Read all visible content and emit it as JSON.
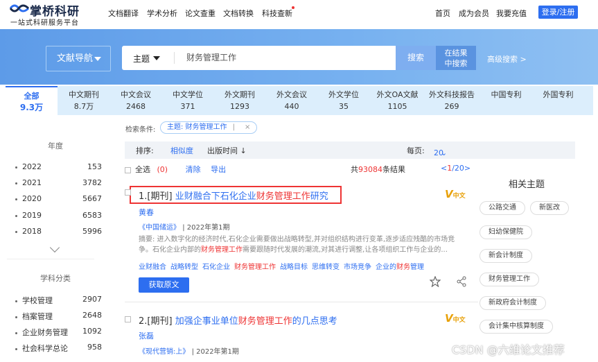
{
  "logo": {
    "brand": "掌桥科研",
    "tagline": "一站式科研服务平台"
  },
  "topnav": [
    "文档翻译",
    "学术分析",
    "论文查重",
    "文档转换",
    "科技查新"
  ],
  "topright": {
    "home": "首页",
    "member": "成为会员",
    "recharge": "我要充值",
    "login": "登录/注册"
  },
  "search": {
    "doc_nav": "文献导航",
    "field": "主题",
    "query": "财务管理工作",
    "search_btn": "搜索",
    "within_btn_l1": "在结果",
    "within_btn_l2": "中搜索",
    "advanced": "高级搜索 >"
  },
  "tabs": [
    {
      "label": "全部",
      "count": "9.3万"
    },
    {
      "label": "中文期刊",
      "count": "8.7万"
    },
    {
      "label": "中文会议",
      "count": "2468"
    },
    {
      "label": "中文学位",
      "count": "371"
    },
    {
      "label": "外文期刊",
      "count": "1293"
    },
    {
      "label": "外文会议",
      "count": "440"
    },
    {
      "label": "外文学位",
      "count": "35"
    },
    {
      "label": "外文OA文献",
      "count": "1105"
    },
    {
      "label": "外文科技报告",
      "count": "269"
    },
    {
      "label": "中国专利",
      "count": ""
    },
    {
      "label": "外国专利",
      "count": ""
    }
  ],
  "sidebar": {
    "year_title": "年度",
    "years": [
      {
        "y": "2022",
        "n": "153"
      },
      {
        "y": "2021",
        "n": "3782"
      },
      {
        "y": "2020",
        "n": "5667"
      },
      {
        "y": "2019",
        "n": "6583"
      },
      {
        "y": "2018",
        "n": "5996"
      }
    ],
    "subject_title": "学科分类",
    "subjects": [
      {
        "y": "学校管理",
        "n": "2907"
      },
      {
        "y": "档案管理",
        "n": "2648"
      },
      {
        "y": "企业财务管理",
        "n": "1092"
      },
      {
        "y": "社会科学总论",
        "n": "958"
      }
    ]
  },
  "filter": {
    "label": "检索条件:",
    "chip": "主题: 财务管理工作",
    "chip_sep": "|",
    "chip_close": "×"
  },
  "sort": {
    "label": "排序:",
    "relevance": "相似度",
    "date": "出版时间 ↓",
    "perpage_label": "每页:",
    "perpage": "20"
  },
  "selbar": {
    "select_all": "全选",
    "selected": "(0)",
    "clear": "清除",
    "export": "导出",
    "total_pre": "共",
    "total": "93084",
    "total_post": "条结果",
    "page_pre": "<",
    "page": "1",
    "page_post": "/20>"
  },
  "results": [
    {
      "index": "1.",
      "type": "[期刊]",
      "title_pre": "业财融合下石化企业",
      "title_hl": "财务管理工作",
      "title_post": "研究",
      "author": "黄春",
      "journal": "《中国储运》",
      "issue": "| 2022年第1期",
      "abstract_pre": "摘要: 进入数字化的经济时代,石化企业需要做出战略转型,并对组织结构进行变革,逐步适应残酷的市场竞争。石化企业内部的",
      "abstract_hl": "财务管理工作",
      "abstract_post": "需要跟随时代发展的潮流,对其进行调整,让各项组织工作与企业的...",
      "keywords": [
        {
          "t": "业财融合",
          "hl": false
        },
        {
          "t": "战略转型",
          "hl": false
        },
        {
          "t": "石化企业",
          "hl": false
        },
        {
          "t": "财务管理工作",
          "hl": true
        },
        {
          "t": "战略目标",
          "hl": false
        },
        {
          "t": "思维转变",
          "hl": false
        },
        {
          "t": "市场竞争",
          "hl": false
        }
      ],
      "kw_last_pre": "企业的",
      "kw_last_hl": "财务",
      "kw_last_post": "管理",
      "get": "获取原文",
      "lang": "中文"
    },
    {
      "index": "2.",
      "type": "[期刊]",
      "title_pre": "加强企事业单位",
      "title_hl": "财务管理工作",
      "title_post": "的几点思考",
      "author": "张磊",
      "journal": "《现代营销:上》",
      "issue": "| 2022年第1期",
      "lang": "中文"
    }
  ],
  "related": {
    "title": "相关主题",
    "tags": [
      "公路交通",
      "新医改",
      "妇幼保健院",
      "新会计制度",
      "财务管理工作",
      "新政府会计制度",
      "会计集中核算制度"
    ]
  },
  "watermark": "CSDN @六维论文推荐",
  "colors": {
    "accent": "#2d6ef0",
    "highlight": "#e33333"
  }
}
